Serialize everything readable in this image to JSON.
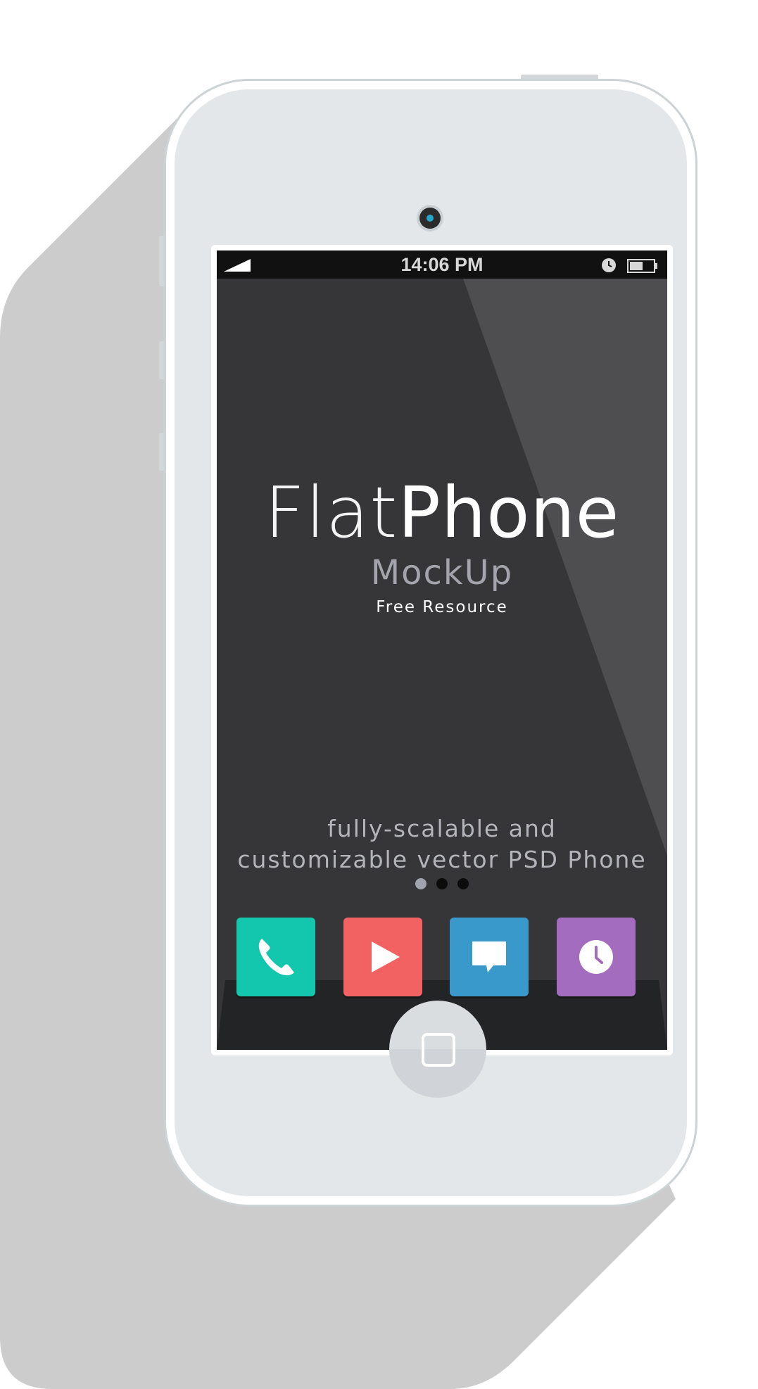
{
  "status_bar": {
    "time": "14:06 PM",
    "icons": [
      "signal-icon",
      "alarm-clock-icon",
      "battery-icon"
    ]
  },
  "hero": {
    "title_part1": "Flat",
    "title_part2": "Phone",
    "subtitle": "MockUp",
    "caption": "Free Resource"
  },
  "tagline": {
    "line1": "fully-scalable and",
    "line2": "customizable vector PSD Phone"
  },
  "page_indicator": {
    "count": 3,
    "active_index": 0
  },
  "dock": {
    "apps": [
      {
        "name": "phone",
        "icon": "phone-icon",
        "color": "#13c6ae"
      },
      {
        "name": "video",
        "icon": "play-icon",
        "color": "#f26262"
      },
      {
        "name": "messages",
        "icon": "message-bubble-icon",
        "color": "#3a99cb"
      },
      {
        "name": "clock",
        "icon": "clock-icon",
        "color": "#a46cbf"
      }
    ]
  },
  "colors": {
    "screen_bg": "#363638",
    "dock_bg": "#232425",
    "device_body": "#e4e7ea",
    "shadow": "#cccccc"
  }
}
